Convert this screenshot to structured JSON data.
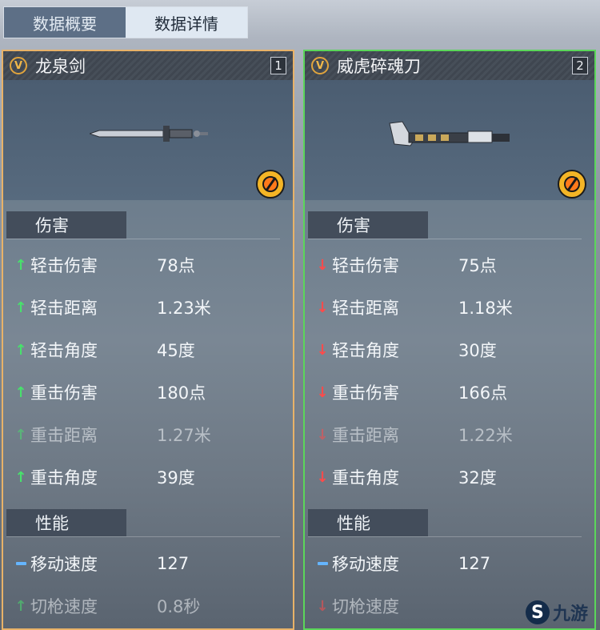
{
  "tabs": [
    {
      "label": "数据概要",
      "active": false
    },
    {
      "label": "数据详情",
      "active": true
    }
  ],
  "cards": [
    {
      "name": "龙泉剑",
      "slot": "1",
      "border_color": "#e8b268",
      "sections": [
        {
          "title": "伤害",
          "stats": [
            {
              "label": "轻击伤害",
              "value": "78点",
              "trend": "up"
            },
            {
              "label": "轻击距离",
              "value": "1.23米",
              "trend": "up"
            },
            {
              "label": "轻击角度",
              "value": "45度",
              "trend": "up"
            },
            {
              "label": "重击伤害",
              "value": "180点",
              "trend": "up"
            },
            {
              "label": "重击距离",
              "value": "1.27米",
              "trend": "up"
            },
            {
              "label": "重击角度",
              "value": "39度",
              "trend": "up"
            }
          ]
        },
        {
          "title": "性能",
          "stats": [
            {
              "label": "移动速度",
              "value": "127",
              "trend": "neutral"
            },
            {
              "label": "切枪速度",
              "value": "0.8秒",
              "trend": "up"
            }
          ]
        }
      ]
    },
    {
      "name": "威虎碎魂刀",
      "slot": "2",
      "border_color": "#5bd65a",
      "sections": [
        {
          "title": "伤害",
          "stats": [
            {
              "label": "轻击伤害",
              "value": "75点",
              "trend": "down"
            },
            {
              "label": "轻击距离",
              "value": "1.18米",
              "trend": "down"
            },
            {
              "label": "轻击角度",
              "value": "30度",
              "trend": "down"
            },
            {
              "label": "重击伤害",
              "value": "166点",
              "trend": "down"
            },
            {
              "label": "重击距离",
              "value": "1.22米",
              "trend": "down"
            },
            {
              "label": "重击角度",
              "value": "32度",
              "trend": "down"
            }
          ]
        },
        {
          "title": "性能",
          "stats": [
            {
              "label": "移动速度",
              "value": "127",
              "trend": "neutral"
            },
            {
              "label": "切枪速度",
              "value": "",
              "trend": "down"
            }
          ]
        }
      ]
    }
  ],
  "watermark": {
    "text": "九游",
    "icon": "jiuyou-logo-icon"
  }
}
